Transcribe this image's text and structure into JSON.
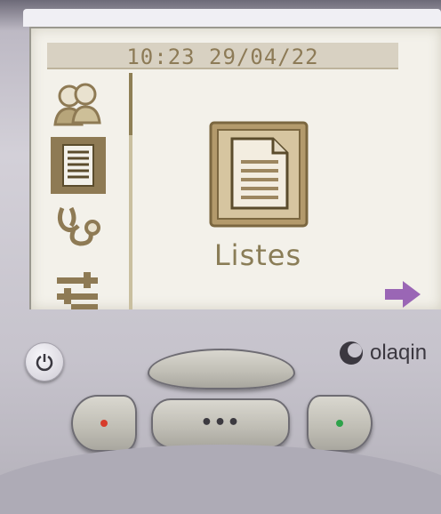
{
  "screen": {
    "status": "10:23 29/04/22",
    "sidebar": [
      {
        "icon": "contacts-icon",
        "selected": false
      },
      {
        "icon": "list-icon",
        "selected": true
      },
      {
        "icon": "stethoscope-icon",
        "selected": false
      },
      {
        "icon": "tools-icon",
        "selected": false
      }
    ],
    "current_menu": "Listes",
    "current_icon": "document-list-icon",
    "next_icon": "right-arrow-icon"
  },
  "device": {
    "brand": "olaqin",
    "power_icon": "power-icon",
    "center_button_label": "•••"
  },
  "colors": {
    "lcd_background": "#f3f1ea",
    "lcd_text": "#8d7b57",
    "selection": "#8e7a54",
    "arrow": "#9a66b5",
    "led_left": "#d73b2b",
    "led_right": "#2ea24a",
    "highlight": "#e41a1a"
  }
}
